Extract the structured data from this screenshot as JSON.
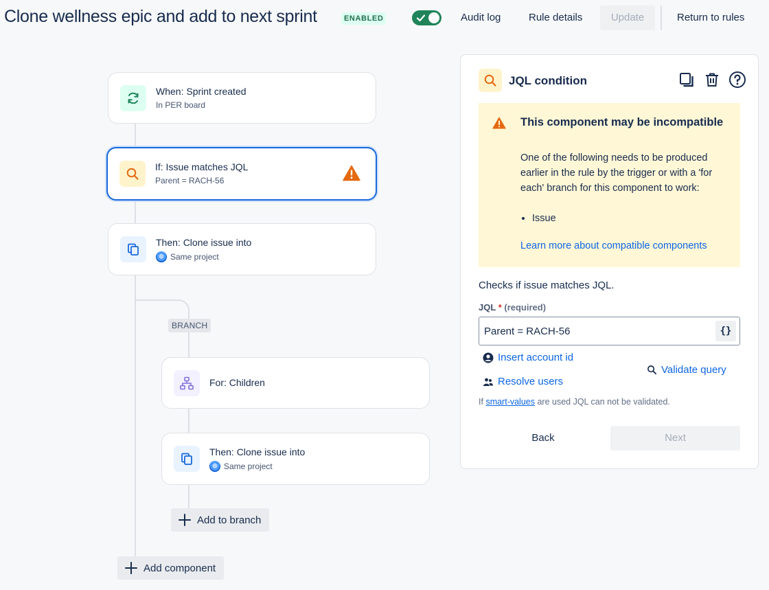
{
  "header": {
    "title": "Clone wellness epic and add to next sprint",
    "status_lozenge": "ENABLED",
    "toggle_on": true,
    "audit_log": "Audit log",
    "rule_details": "Rule details",
    "update": "Update",
    "return_to_rules": "Return to rules"
  },
  "flow": {
    "trigger": {
      "title": "When: Sprint created",
      "subtitle": "In PER board",
      "icon": "refresh-icon"
    },
    "condition": {
      "title": "If: Issue matches JQL",
      "subtitle": "Parent = RACH-56",
      "icon": "search-icon",
      "warning": true
    },
    "action": {
      "title": "Then: Clone issue into",
      "subtitle": "Same project",
      "icon": "copy-icon"
    },
    "branch_label": "BRANCH",
    "branch_for": {
      "title": "For: Children",
      "icon": "hierarchy-icon"
    },
    "branch_action": {
      "title": "Then: Clone issue into",
      "subtitle": "Same project",
      "icon": "copy-icon"
    },
    "add_to_branch": "Add to branch",
    "add_component": "Add component"
  },
  "panel": {
    "title": "JQL condition",
    "tools": [
      "duplicate-icon",
      "trash-icon",
      "help-icon"
    ],
    "warning": {
      "title": "This component may be incompatible",
      "body": "One of the following needs to be produced earlier in the rule by the trigger or with a 'for each' branch for this component to work:",
      "items": [
        "Issue"
      ],
      "link": "Learn more about compatible components"
    },
    "description": "Checks if issue matches JQL.",
    "field_label": "JQL",
    "required_mark": "*",
    "required_text": "(required)",
    "jql_value": "Parent = RACH-56",
    "smart_values_button": "{}",
    "insert_account_id": "Insert account id",
    "resolve_users": "Resolve users",
    "validate_query": "Validate query",
    "help_prefix": "If",
    "help_link": "smart-values",
    "help_suffix": "are used JQL can not be validated.",
    "back": "Back",
    "next": "Next"
  },
  "colors": {
    "accent": "#1868db",
    "warning": "#e56910",
    "toggle": "#1f845a",
    "link": "#0c66e4"
  }
}
